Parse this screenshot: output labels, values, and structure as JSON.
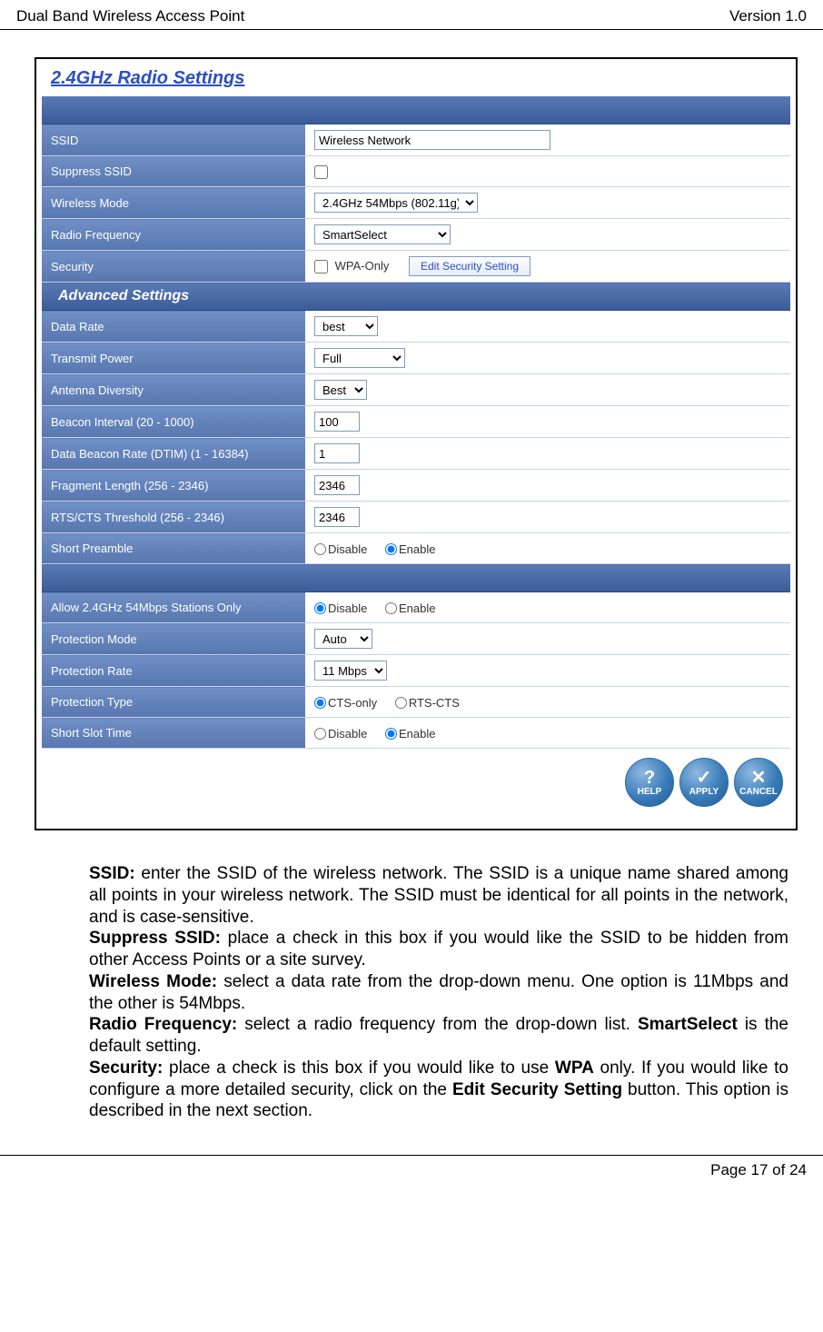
{
  "header": {
    "left": "Dual Band Wireless Access Point",
    "right": "Version 1.0"
  },
  "footer": {
    "text": "Page 17 of 24"
  },
  "panel": {
    "title": "2.4GHz Radio Settings",
    "advanced_title": "Advanced Settings",
    "basic": {
      "ssid_label": "SSID",
      "ssid_value": "Wireless Network",
      "suppress_label": "Suppress SSID",
      "mode_label": "Wireless Mode",
      "mode_value": "2.4GHz 54Mbps (802.11g)",
      "freq_label": "Radio Frequency",
      "freq_value": "SmartSelect",
      "security_label": "Security",
      "wpa_label": "WPA-Only",
      "edit_btn": "Edit Security Setting"
    },
    "advanced": {
      "datarate_label": "Data Rate",
      "datarate_value": "best",
      "txpower_label": "Transmit Power",
      "txpower_value": "Full",
      "antenna_label": "Antenna Diversity",
      "antenna_value": "Best",
      "beacon_label": "Beacon Interval (20 - 1000)",
      "beacon_value": "100",
      "dtim_label": "Data Beacon Rate (DTIM) (1 - 16384)",
      "dtim_value": "1",
      "frag_label": "Fragment Length (256 - 2346)",
      "frag_value": "2346",
      "rtscts_label": "RTS/CTS Threshold (256 - 2346)",
      "rtscts_value": "2346",
      "preamble_label": "Short Preamble",
      "disable": "Disable",
      "enable": "Enable"
    },
    "extra": {
      "allow_label": "Allow 2.4GHz 54Mbps Stations Only",
      "prot_mode_label": "Protection Mode",
      "prot_mode_value": "Auto",
      "prot_rate_label": "Protection Rate",
      "prot_rate_value": "11 Mbps",
      "prot_type_label": "Protection Type",
      "cts_only": "CTS-only",
      "rts_cts": "RTS-CTS",
      "slot_label": "Short Slot Time"
    },
    "buttons": {
      "help": "HELP",
      "apply": "APPLY",
      "cancel": "CANCEL"
    }
  },
  "descriptions": {
    "ssid_b": "SSID:",
    "ssid_t": " enter the SSID of the wireless network. The SSID is a unique name shared among all points in your wireless network. The SSID must be identical for all points in the network, and is case-sensitive.",
    "supp_b": "Suppress SSID:",
    "supp_t": "  place a check in this box if you would like the SSID to be hidden from other Access Points or a site survey.",
    "mode_b": "Wireless Mode:",
    "mode_t": " select a data rate from the drop-down menu. One option is 11Mbps and the other is 54Mbps.",
    "freq_b": "Radio Frequency:",
    "freq_t1": " select a radio frequency from the drop-down list. ",
    "freq_b2": "SmartSelect",
    "freq_t2": " is the default setting.",
    "sec_b": "Security:",
    "sec_t1": " place a check is this box if you would like to use ",
    "sec_b2": "WPA",
    "sec_t2": " only. If you would like to configure a more detailed security, click on the ",
    "sec_b3": "Edit Security Setting",
    "sec_t3": " button.  This option is described in the next section."
  }
}
